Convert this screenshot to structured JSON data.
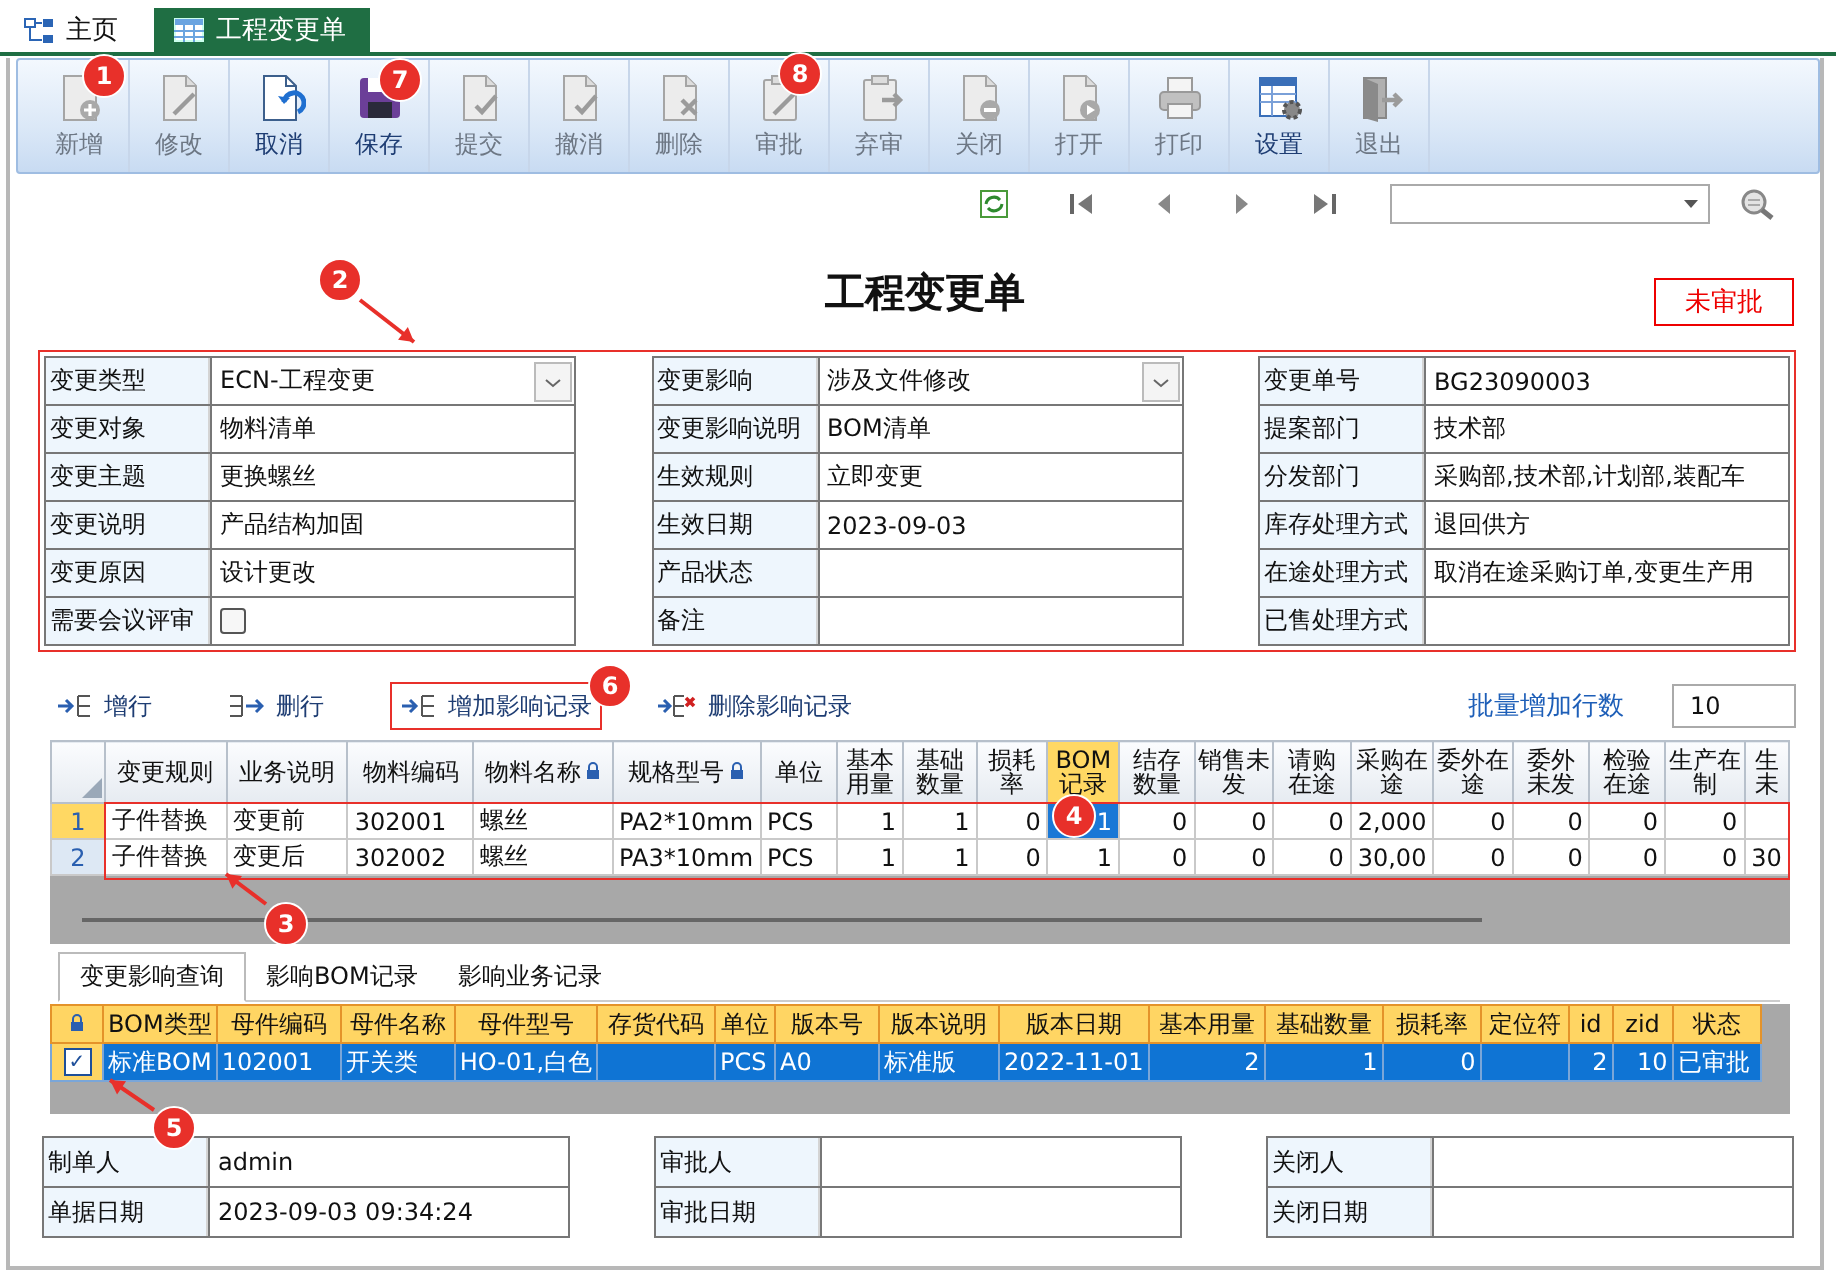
{
  "tabs": [
    {
      "label": "主页",
      "kind": "home",
      "selected": false
    },
    {
      "label": "工程变更单",
      "kind": "table",
      "selected": true
    }
  ],
  "toolbar": [
    {
      "label": "新增",
      "kind": "add",
      "disabled": true
    },
    {
      "label": "修改",
      "kind": "edit",
      "disabled": true
    },
    {
      "label": "取消",
      "kind": "cancel",
      "disabled": false
    },
    {
      "label": "保存",
      "kind": "save",
      "disabled": false
    },
    {
      "label": "提交",
      "kind": "submit",
      "disabled": true
    },
    {
      "label": "撤消",
      "kind": "revoke",
      "disabled": true
    },
    {
      "label": "删除",
      "kind": "delete",
      "disabled": true
    },
    {
      "label": "审批",
      "kind": "approve",
      "disabled": true
    },
    {
      "label": "弃审",
      "kind": "abandon",
      "disabled": true
    },
    {
      "label": "关闭",
      "kind": "close",
      "disabled": true
    },
    {
      "label": "打开",
      "kind": "open",
      "disabled": true
    },
    {
      "label": "打印",
      "kind": "print",
      "disabled": true
    },
    {
      "label": "设置",
      "kind": "settings",
      "disabled": false
    },
    {
      "label": "退出",
      "kind": "exit",
      "disabled": true
    }
  ],
  "title": "工程变更单",
  "status": "未审批",
  "form": [
    [
      {
        "label": "变更类型",
        "value": "ECN-工程变更",
        "kind": "select"
      },
      {
        "label": "变更对象",
        "value": "物料清单",
        "kind": "text"
      },
      {
        "label": "变更主题",
        "value": "更换螺丝",
        "kind": "text"
      },
      {
        "label": "变更说明",
        "value": "产品结构加固",
        "kind": "text"
      },
      {
        "label": "变更原因",
        "value": "设计更改",
        "kind": "text"
      },
      {
        "label": "需要会议评审",
        "kind": "checkbox",
        "checked": false
      }
    ],
    [
      {
        "label": "变更影响",
        "value": "涉及文件修改",
        "kind": "select"
      },
      {
        "label": "变更影响说明",
        "value": "BOM清单",
        "kind": "text"
      },
      {
        "label": "生效规则",
        "value": "立即变更",
        "kind": "text"
      },
      {
        "label": "生效日期",
        "value": "2023-09-03",
        "kind": "text"
      },
      {
        "label": "产品状态",
        "kind": "text"
      },
      {
        "label": "备注",
        "kind": "text"
      }
    ],
    [
      {
        "label": "变更单号",
        "value": "BG23090003",
        "kind": "text"
      },
      {
        "label": "提案部门",
        "value": "技术部",
        "kind": "text"
      },
      {
        "label": "分发部门",
        "value": "采购部,技术部,计划部,装配车",
        "kind": "text"
      },
      {
        "label": "库存处理方式",
        "value": "退回供方",
        "kind": "text"
      },
      {
        "label": "在途处理方式",
        "value": "取消在途采购订单,变更生产用",
        "kind": "text"
      },
      {
        "label": "已售处理方式",
        "kind": "text"
      }
    ]
  ],
  "grid_toolbar": [
    {
      "label": "增行",
      "kind": "add-row"
    },
    {
      "label": "删行",
      "kind": "delete-row"
    },
    {
      "label": "增加影响记录",
      "kind": "add-row"
    },
    {
      "label": "删除影响记录",
      "kind": "delete-record"
    }
  ],
  "batch": {
    "label": "批量增加行数",
    "value": "10"
  },
  "grid": {
    "columns": [
      {
        "label": "变更规则",
        "kind": "text",
        "locked": false,
        "highlighted": false
      },
      {
        "label": "业务说明",
        "kind": "text",
        "locked": false,
        "highlighted": false
      },
      {
        "label": "物料编码",
        "kind": "text",
        "locked": false,
        "highlighted": false
      },
      {
        "label": "物料名称",
        "kind": "text",
        "locked": true,
        "highlighted": false
      },
      {
        "label": "规格型号",
        "kind": "text",
        "locked": true,
        "highlighted": false
      },
      {
        "label": "单位",
        "kind": "text",
        "locked": false,
        "highlighted": false
      },
      {
        "label": "基本用量",
        "kind": "number",
        "locked": false,
        "highlighted": false
      },
      {
        "label": "基础数量",
        "kind": "number",
        "locked": false,
        "highlighted": false
      },
      {
        "label": "损耗率",
        "kind": "number",
        "locked": false,
        "highlighted": false
      },
      {
        "label": "BOM记录",
        "kind": "number",
        "locked": false,
        "highlighted": true
      },
      {
        "label": "结存数量",
        "kind": "number",
        "locked": false,
        "highlighted": false
      },
      {
        "label": "销售未发",
        "kind": "number",
        "locked": false,
        "highlighted": false
      },
      {
        "label": "请购在途",
        "kind": "number",
        "locked": false,
        "highlighted": false
      },
      {
        "label": "采购在途",
        "kind": "number",
        "locked": false,
        "highlighted": false
      },
      {
        "label": "委外在途",
        "kind": "number",
        "locked": false,
        "highlighted": false
      },
      {
        "label": "委外未发",
        "kind": "number",
        "locked": false,
        "highlighted": false
      },
      {
        "label": "检验在途",
        "kind": "number",
        "locked": false,
        "highlighted": false
      },
      {
        "label": "生产在制",
        "kind": "number",
        "locked": false,
        "highlighted": false
      },
      {
        "label": "生未",
        "kind": "text",
        "locked": false,
        "highlighted": false
      }
    ],
    "rows": [
      {
        "index": "1",
        "selected": true,
        "cells": [
          "子件替换",
          "变更前",
          "302001",
          "螺丝",
          "PA2*10mm",
          "PCS",
          "1",
          "1",
          "0",
          "1",
          "0",
          "0",
          "0",
          "2,000",
          "0",
          "0",
          "0",
          "0",
          ""
        ]
      },
      {
        "index": "2",
        "selected": false,
        "cells": [
          "子件替换",
          "变更后",
          "302002",
          "螺丝",
          "PA3*10mm",
          "PCS",
          "1",
          "1",
          "0",
          "1",
          "0",
          "0",
          "0",
          "30,00",
          "0",
          "0",
          "0",
          "0",
          "30"
        ]
      }
    ]
  },
  "detail_tabs": [
    {
      "label": "变更影响查询",
      "selected": true
    },
    {
      "label": "影响BOM记录",
      "selected": false
    },
    {
      "label": "影响业务记录",
      "selected": false
    }
  ],
  "detail_grid": {
    "columns": [
      {
        "label": "BOM类型",
        "kind": "text"
      },
      {
        "label": "母件编码",
        "kind": "text"
      },
      {
        "label": "母件名称",
        "kind": "text"
      },
      {
        "label": "母件型号",
        "kind": "text"
      },
      {
        "label": "存货代码",
        "kind": "text"
      },
      {
        "label": "单位",
        "kind": "text"
      },
      {
        "label": "版本号",
        "kind": "text"
      },
      {
        "label": "版本说明",
        "kind": "text"
      },
      {
        "label": "版本日期",
        "kind": "text"
      },
      {
        "label": "基本用量",
        "kind": "number"
      },
      {
        "label": "基础数量",
        "kind": "number"
      },
      {
        "label": "损耗率",
        "kind": "number"
      },
      {
        "label": "定位符",
        "kind": "text"
      },
      {
        "label": "id",
        "kind": "number"
      },
      {
        "label": "zid",
        "kind": "number"
      },
      {
        "label": "状态",
        "kind": "text"
      }
    ],
    "rows": [
      {
        "checked": true,
        "selected": true,
        "cells": [
          "标准BOM",
          "102001",
          "开关类",
          "HO-01,白色",
          "",
          "PCS",
          "A0",
          "标准版",
          "2022-11-01",
          "2",
          "1",
          "0",
          "",
          "2",
          "10",
          "已审批"
        ]
      }
    ]
  },
  "footer": [
    [
      {
        "label": "制单人",
        "value": "admin"
      },
      {
        "label": "单据日期",
        "value": "2023-09-03 09:34:24"
      }
    ],
    [
      {
        "label": "审批人"
      },
      {
        "label": "审批日期"
      }
    ],
    [
      {
        "label": "关闭人"
      },
      {
        "label": "关闭日期"
      }
    ]
  ],
  "annotations": [
    {
      "label": "1",
      "arrow": false
    },
    {
      "label": "7",
      "arrow": false
    },
    {
      "label": "8",
      "arrow": false
    },
    {
      "label": "2",
      "arrow": true
    },
    {
      "label": "6",
      "arrow": false
    },
    {
      "label": "4",
      "arrow": false
    },
    {
      "label": "3",
      "arrow": true
    },
    {
      "label": "5",
      "arrow": true
    }
  ]
}
